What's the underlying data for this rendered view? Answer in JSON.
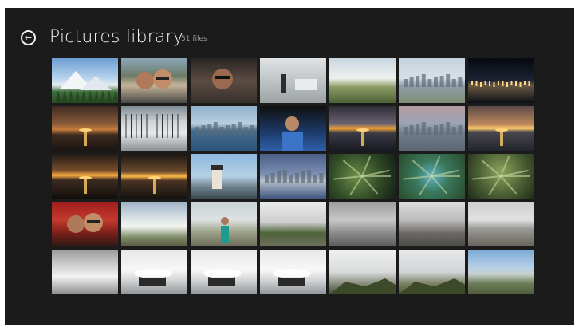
{
  "header": {
    "back_icon": "back-arrow-icon",
    "title": "Pictures library",
    "count": "51 files"
  },
  "colors": {
    "screen_bg": "#1b1b1b",
    "title_text": "#f2f2f2",
    "count_text": "#9a9a9a"
  },
  "photos": [
    {
      "label": "mountain-landscape",
      "theme": "t-mtn"
    },
    {
      "label": "couple-selfie",
      "theme": "t-selfie"
    },
    {
      "label": "man-in-car",
      "theme": "t-car"
    },
    {
      "label": "plaza-fountain",
      "theme": "t-plaza"
    },
    {
      "label": "green-field",
      "theme": "t-field"
    },
    {
      "label": "city-waterfront",
      "theme": "t-city"
    },
    {
      "label": "night-skyline",
      "theme": "t-night"
    },
    {
      "label": "dusk-shore",
      "theme": "t-dusk"
    },
    {
      "label": "harbor-boats",
      "theme": "t-harbor"
    },
    {
      "label": "bay-view",
      "theme": "t-bay"
    },
    {
      "label": "person-portrait",
      "theme": "t-person"
    },
    {
      "label": "sunset-sea",
      "theme": "t-sun1"
    },
    {
      "label": "city-panorama",
      "theme": "t-sfcity"
    },
    {
      "label": "sunset-clouds",
      "theme": "t-sun2"
    },
    {
      "label": "sunset-water",
      "theme": "t-sun3"
    },
    {
      "label": "sunset-horizon",
      "theme": "t-sun4"
    },
    {
      "label": "lighthouse",
      "theme": "t-light"
    },
    {
      "label": "bay-city-dusk",
      "theme": "t-bayc"
    },
    {
      "label": "fern-leaves",
      "theme": "t-fern"
    },
    {
      "label": "succulent",
      "theme": "t-succ"
    },
    {
      "label": "agave-plant",
      "theme": "t-agave"
    },
    {
      "label": "couple-portrait",
      "theme": "t-couple"
    },
    {
      "label": "coastline",
      "theme": "t-coast"
    },
    {
      "label": "woman-coast",
      "theme": "t-woman"
    },
    {
      "label": "grassy-hill",
      "theme": "t-hill"
    },
    {
      "label": "gray-sea",
      "theme": "t-gray1"
    },
    {
      "label": "gray-beach",
      "theme": "t-gray2"
    },
    {
      "label": "gray-shore",
      "theme": "t-gray3"
    },
    {
      "label": "surf-shore",
      "theme": "t-shore"
    },
    {
      "label": "wave-rocks-1",
      "theme": "t-waves"
    },
    {
      "label": "wave-rocks-2",
      "theme": "t-waves"
    },
    {
      "label": "wave-rocks-3",
      "theme": "t-waves"
    },
    {
      "label": "foggy-hills-1",
      "theme": "t-fog"
    },
    {
      "label": "foggy-hills-2",
      "theme": "t-fog2"
    },
    {
      "label": "blue-coast",
      "theme": "t-blue"
    }
  ]
}
